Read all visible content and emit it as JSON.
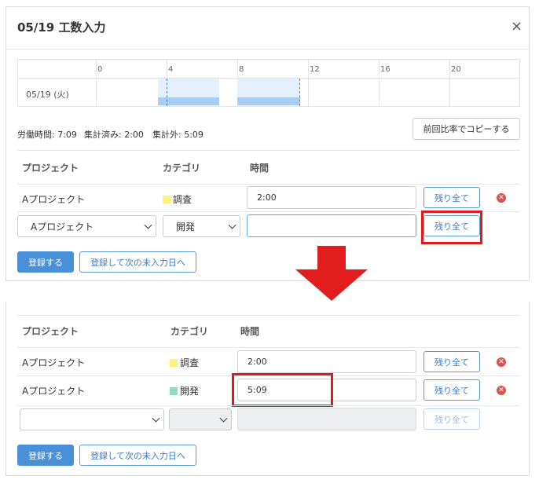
{
  "dialog": {
    "title": "05/19 工数入力",
    "close_glyph": "×"
  },
  "timeline": {
    "row_label": "05/19 (火)",
    "ticks": [
      "0",
      "4",
      "8",
      "12",
      "16",
      "20"
    ]
  },
  "summary": {
    "work_time": "労働時間: 7:09",
    "counted": "集計済み: 2:00",
    "uncounted": "集計外: 5:09",
    "copy_button": "前回比率でコピーする"
  },
  "table": {
    "col_project": "プロジェクト",
    "col_category": "カテゴリ",
    "col_time": "時間"
  },
  "before": {
    "rows": [
      {
        "project": "Aプロジェクト",
        "category": "調査",
        "category_color": "#fff17a",
        "time": "2:00",
        "fill_label": "残り全て"
      }
    ],
    "edit_row": {
      "project": "Aプロジェクト",
      "category": "開発",
      "time": "",
      "fill_label": "残り全て"
    },
    "register": "登録する",
    "register_next": "登録して次の未入力日へ"
  },
  "after": {
    "rows": [
      {
        "project": "Aプロジェクト",
        "category": "調査",
        "category_color": "#fff17a",
        "time": "2:00",
        "fill_label": "残り全て"
      },
      {
        "project": "Aプロジェクト",
        "category": "開発",
        "category_color": "#8fdcc4",
        "time": "5:09",
        "fill_label": "残り全て"
      }
    ],
    "edit_row": {
      "project": "",
      "category": "",
      "time": "",
      "fill_label": "残り全て"
    },
    "register": "登録する",
    "register_next": "登録して次の未入力日へ"
  },
  "icons": {
    "delete": "delete-circle-icon",
    "arrow": "down-arrow-icon"
  },
  "colors": {
    "accent": "#4a90d9",
    "highlight": "#e01b1b",
    "bar": "#a9cdf3"
  }
}
